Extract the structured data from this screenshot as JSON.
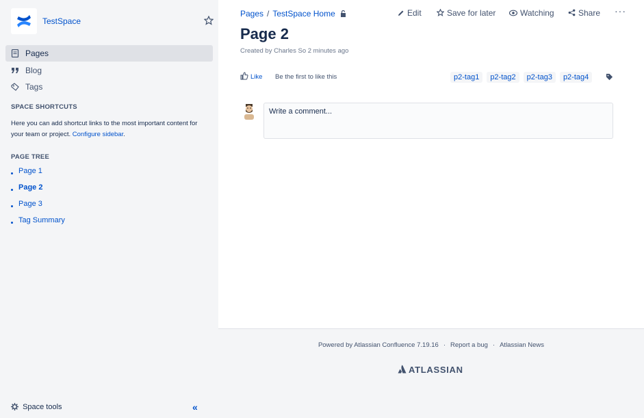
{
  "space": {
    "name": "TestSpace"
  },
  "sidebar": {
    "nav": [
      {
        "label": "Pages",
        "icon": "pages-icon"
      },
      {
        "label": "Blog",
        "icon": "quote-icon"
      },
      {
        "label": "Tags",
        "icon": "tags-icon"
      }
    ],
    "shortcuts_heading": "SPACE SHORTCUTS",
    "shortcuts_text": "Here you can add shortcut links to the most important content for your team or project.",
    "shortcuts_link": "Configure sidebar",
    "shortcuts_tail": ".",
    "tree_heading": "PAGE TREE",
    "tree": [
      "Page 1",
      "Page 2",
      "Page 3",
      "Tag Summary"
    ],
    "space_tools": "Space tools"
  },
  "breadcrumb": {
    "items": [
      "Pages",
      "TestSpace Home"
    ],
    "separator": "/"
  },
  "actions": {
    "edit": "Edit",
    "save_for_later": "Save for later",
    "watching": "Watching",
    "share": "Share",
    "more": "···"
  },
  "page": {
    "title": "Page 2",
    "byline": "Created by Charles So 2 minutes ago"
  },
  "likes": {
    "like_label": "Like",
    "like_text": "Be the first to like this"
  },
  "labels": [
    "p2-tag1",
    "p2-tag2",
    "p2-tag3",
    "p2-tag4"
  ],
  "comment": {
    "placeholder": "Write a comment..."
  },
  "footer": {
    "powered_by": "Powered by Atlassian Confluence 7.19.16",
    "report_bug": "Report a bug",
    "news": "Atlassian News",
    "dot": "·",
    "logo_text": "ATLASSIAN"
  },
  "colors": {
    "link": "#0052cc",
    "sidebar_bg": "#f4f5f7",
    "text": "#172b4d"
  }
}
